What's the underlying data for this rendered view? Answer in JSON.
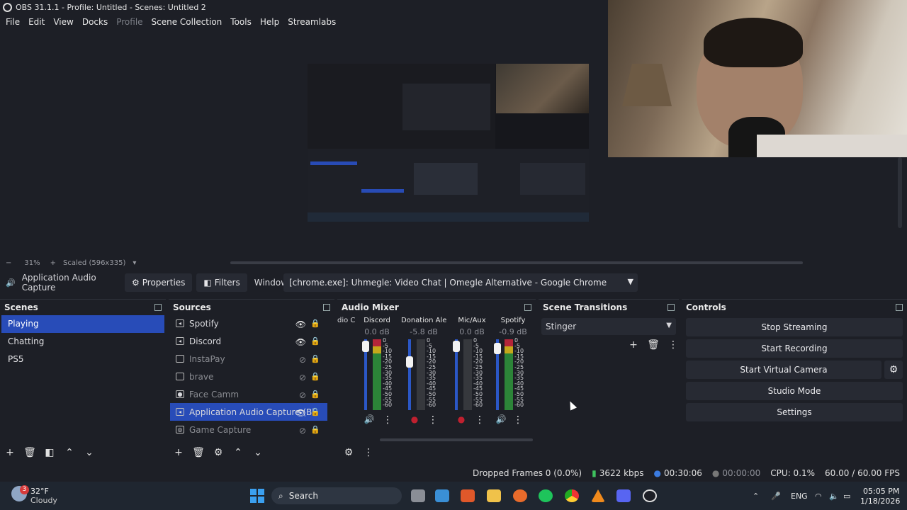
{
  "window": {
    "title": "OBS 31.1.1 - Profile: Untitled - Scenes: Untitled 2"
  },
  "menu": [
    "File",
    "Edit",
    "View",
    "Docks",
    "Profile",
    "Scene Collection",
    "Tools",
    "Help",
    "Streamlabs"
  ],
  "preview": {
    "zoom": "31%",
    "scale_label": "Scaled (596x335)",
    "minus": "−",
    "plus": "+"
  },
  "source_toolbar": {
    "source_name": "Application Audio Capture",
    "properties": "Properties",
    "filters": "Filters",
    "window_label": "Window",
    "window_value": "[chrome.exe]: Uhmegle: Video Chat | Omegle Alternative - Google Chrome"
  },
  "scenes": {
    "title": "Scenes",
    "items": [
      "Playing",
      "Chatting",
      "PS5"
    ],
    "selected": 0
  },
  "sources": {
    "title": "Sources",
    "items": [
      {
        "name": "Spotify",
        "visible": true
      },
      {
        "name": "Discord",
        "visible": true
      },
      {
        "name": "InstaPay",
        "visible": false
      },
      {
        "name": "brave",
        "visible": false
      },
      {
        "name": "Face Camm",
        "visible": false
      },
      {
        "name": "Application Audio Capture (Bl",
        "visible": true,
        "selected": true
      },
      {
        "name": "Game Capture",
        "visible": false
      }
    ]
  },
  "mixer": {
    "title": "Audio Mixer",
    "partial_label": "dio C",
    "channels": [
      {
        "name": "Discord",
        "db": "0.0 dB",
        "level": 1.0,
        "muted": false
      },
      {
        "name": "Donation Alert",
        "db": "-5.8 dB",
        "level": 0.8,
        "muted": true
      },
      {
        "name": "Mic/Aux",
        "db": "0.0 dB",
        "level": 1.0,
        "muted": true
      },
      {
        "name": "Spotify",
        "db": "-0.9 dB",
        "level": 0.95,
        "muted": false
      }
    ],
    "scale": [
      "0",
      "-5",
      "-10",
      "-15",
      "-20",
      "-25",
      "-30",
      "-35",
      "-40",
      "-45",
      "-50",
      "-55",
      "-60"
    ]
  },
  "transitions": {
    "title": "Scene Transitions",
    "selected": "Stinger"
  },
  "controls": {
    "title": "Controls",
    "stop_streaming": "Stop Streaming",
    "start_recording": "Start Recording",
    "start_virtual_camera": "Start Virtual Camera",
    "studio_mode": "Studio Mode",
    "settings": "Settings"
  },
  "status": {
    "dropped_frames": "Dropped Frames 0 (0.0%)",
    "bitrate": "3622 kbps",
    "stream_time": "00:30:06",
    "rec_time": "00:00:00",
    "cpu": "CPU: 0.1%",
    "fps": "60.00 / 60.00 FPS"
  },
  "taskbar": {
    "weather_temp": "32°F",
    "weather_desc": "Cloudy",
    "weather_badge": "3",
    "search": "Search",
    "lang": "ENG",
    "time": "05:05 PM",
    "date": "1/18/2026"
  }
}
